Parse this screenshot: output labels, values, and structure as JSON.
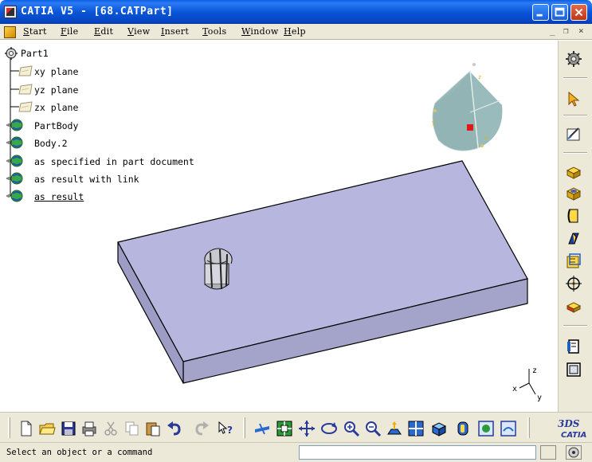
{
  "window": {
    "title": "CATIA V5 - [68.CATPart]"
  },
  "menu": {
    "items": [
      "Start",
      "File",
      "Edit",
      "View",
      "Insert",
      "Tools",
      "Window",
      "Help"
    ],
    "mdi_controls": [
      "_",
      "Б",
      "×"
    ]
  },
  "tree": {
    "root": "Part1",
    "nodes": [
      {
        "label": "xy plane",
        "icon": "plane-icon"
      },
      {
        "label": "yz plane",
        "icon": "plane-icon"
      },
      {
        "label": "zx plane",
        "icon": "plane-icon"
      },
      {
        "label": "PartBody",
        "icon": "body-icon"
      },
      {
        "label": "Body.2",
        "icon": "body-icon"
      },
      {
        "label": "as specified in part document",
        "icon": "body-icon"
      },
      {
        "label": "as result with link",
        "icon": "body-icon"
      },
      {
        "label": "as result",
        "icon": "body-icon",
        "underlined": true
      }
    ]
  },
  "compass": {
    "axis_labels": [
      "y",
      "z",
      "x"
    ]
  },
  "axis_triad": {
    "labels": [
      "z",
      "x",
      "y"
    ]
  },
  "status": {
    "message": "Select an object or a command",
    "command_input": ""
  },
  "brand": {
    "logo_text": "CATIA",
    "logo_mark": "3DS"
  },
  "colors": {
    "titlebar": "#0a56d8",
    "chrome": "#ece9d8",
    "part_top": "#b4b4dc",
    "part_side": "#a2a2c8"
  }
}
